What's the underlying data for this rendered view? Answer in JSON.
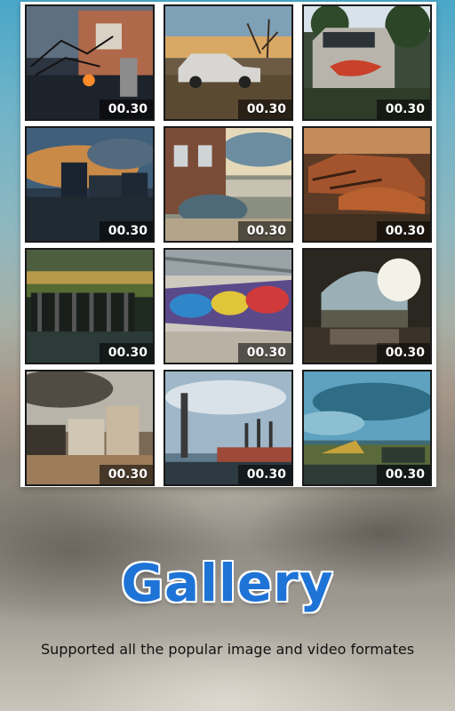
{
  "colors": {
    "title": "#1e73d6",
    "panel": "#ffffff",
    "badge_bg": "rgba(0,0,0,0.55)"
  },
  "gallery": {
    "items": [
      {
        "duration": "00.30",
        "icon": "urban-wall-barbed-wire-thumbnail"
      },
      {
        "duration": "00.30",
        "icon": "abandoned-car-field-thumbnail"
      },
      {
        "duration": "00.30",
        "icon": "rusty-van-thumbnail"
      },
      {
        "duration": "00.30",
        "icon": "city-skyline-thumbnail"
      },
      {
        "duration": "00.30",
        "icon": "brick-building-graffiti-thumbnail"
      },
      {
        "duration": "00.30",
        "icon": "rusted-car-wreck-thumbnail"
      },
      {
        "duration": "00.30",
        "icon": "dock-pier-thumbnail"
      },
      {
        "duration": "00.30",
        "icon": "graffiti-tunnel-thumbnail"
      },
      {
        "duration": "00.30",
        "icon": "ruined-arch-thumbnail"
      },
      {
        "duration": "00.30",
        "icon": "old-buildings-thumbnail"
      },
      {
        "duration": "00.30",
        "icon": "power-station-chimneys-thumbnail"
      },
      {
        "duration": "00.30",
        "icon": "industrial-harbor-thumbnail"
      }
    ]
  },
  "heading": {
    "title": "Gallery",
    "subtitle": "Supported all the popular image and video formates"
  }
}
